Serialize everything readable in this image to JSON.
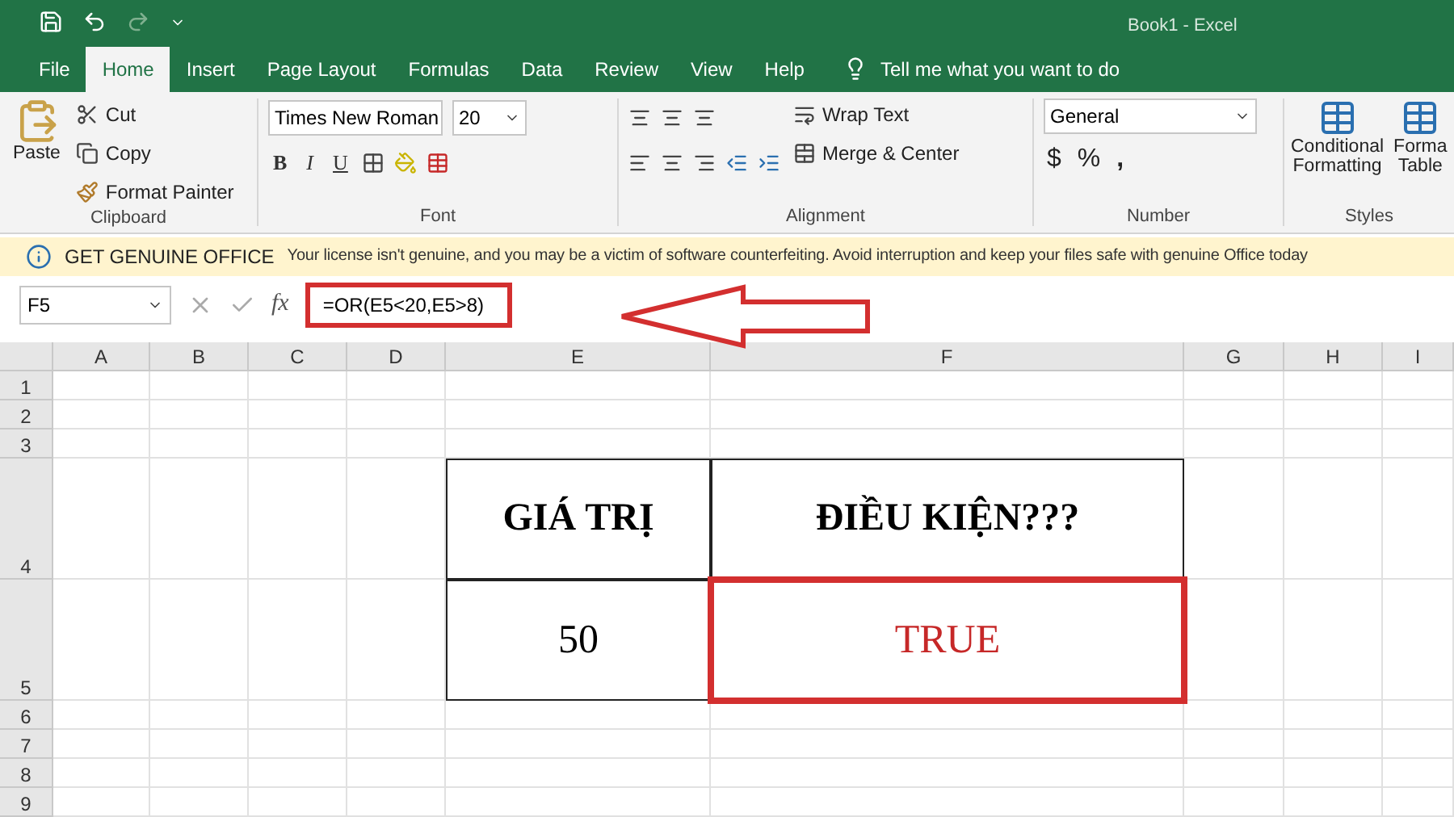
{
  "window": {
    "title": "Book1 - Excel"
  },
  "tabs": [
    {
      "label": "File",
      "selected": false
    },
    {
      "label": "Home",
      "selected": true
    },
    {
      "label": "Insert",
      "selected": false
    },
    {
      "label": "Page Layout",
      "selected": false
    },
    {
      "label": "Formulas",
      "selected": false
    },
    {
      "label": "Data",
      "selected": false
    },
    {
      "label": "Review",
      "selected": false
    },
    {
      "label": "View",
      "selected": false
    },
    {
      "label": "Help",
      "selected": false
    }
  ],
  "tell_me": {
    "placeholder": "Tell me what you want to do"
  },
  "ribbon": {
    "clipboard": {
      "paste": "Paste",
      "cut": "Cut",
      "copy": "Copy",
      "format_painter": "Format Painter",
      "label": "Clipboard"
    },
    "font": {
      "font_name": "Times New Roman",
      "font_size": "20",
      "bold": "B",
      "italic": "I",
      "underline": "U",
      "label": "Font"
    },
    "alignment": {
      "wrap_text": "Wrap Text",
      "merge_center": "Merge & Center",
      "label": "Alignment"
    },
    "number": {
      "format": "General",
      "currency": "$",
      "percent": "%",
      "comma": ",",
      "label": "Number"
    },
    "styles": {
      "conditional_formatting": [
        "Conditional",
        "Formatting"
      ],
      "format_table": [
        "Forma",
        "Table"
      ],
      "label": "Styles"
    }
  },
  "info_bar": {
    "title": "GET GENUINE OFFICE",
    "message": "Your license isn't genuine, and you may be a victim of software counterfeiting. Avoid interruption and keep your files safe with genuine Office today"
  },
  "formula_bar": {
    "name_box": "F5",
    "function_label": "fx",
    "formula": "=OR(E5<20,E5>8)"
  },
  "sheet": {
    "columns": [
      "A",
      "B",
      "C",
      "D",
      "E",
      "F",
      "G",
      "H",
      "I"
    ],
    "rows": [
      {
        "label": "1"
      },
      {
        "label": "2"
      },
      {
        "label": "3"
      },
      {
        "label": "4",
        "cells": [
          {
            "text": "GIÁ TRỊ",
            "kind": "heading",
            "selected": false
          },
          {
            "text": "ĐIỀU KIỆN???",
            "kind": "heading",
            "selected": false
          }
        ]
      },
      {
        "label": "5",
        "cells": [
          {
            "text": "50",
            "kind": "value",
            "selected": false
          },
          {
            "text": "TRUE",
            "kind": "value",
            "selected": true
          }
        ]
      },
      {
        "label": "6"
      },
      {
        "label": "7"
      },
      {
        "label": "8"
      },
      {
        "label": "9"
      }
    ]
  }
}
